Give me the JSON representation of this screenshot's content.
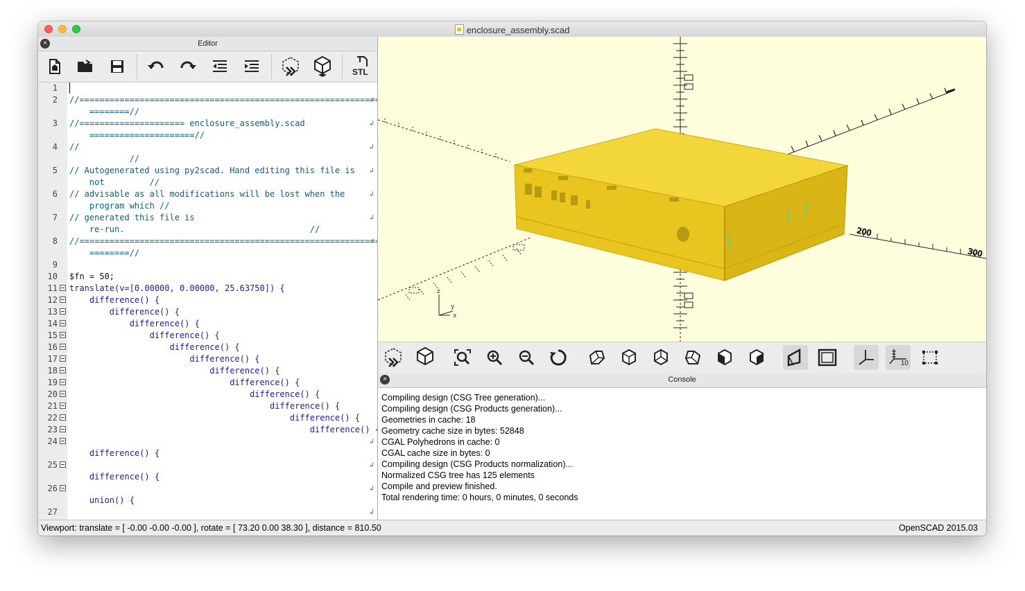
{
  "window": {
    "title": "enclosure_assembly.scad"
  },
  "editor": {
    "title": "Editor",
    "close_glyph": "×",
    "toolbar": [
      {
        "name": "new-file-icon"
      },
      {
        "name": "open-file-icon"
      },
      {
        "name": "save-icon"
      },
      {
        "name": "undo-icon"
      },
      {
        "name": "redo-icon"
      },
      {
        "name": "unindent-icon"
      },
      {
        "name": "indent-icon"
      },
      {
        "name": "preview-icon"
      },
      {
        "name": "render-icon"
      },
      {
        "name": "export-stl-icon",
        "label": "STL"
      }
    ],
    "lines": [
      {
        "n": "1",
        "text": "",
        "color": "teal"
      },
      {
        "n": "2",
        "text": "//================================================================",
        "color": "teal",
        "wrap": true
      },
      {
        "n": "",
        "text": "    ========//",
        "color": "teal"
      },
      {
        "n": "3",
        "text": "//===================== enclosure_assembly.scad",
        "color": "teal",
        "wrap": true
      },
      {
        "n": "",
        "text": "    =====================//",
        "color": "teal"
      },
      {
        "n": "4",
        "text": "//",
        "color": "teal",
        "wrap": true
      },
      {
        "n": "",
        "text": "            //",
        "color": "teal"
      },
      {
        "n": "5",
        "text": "// Autogenerated using py2scad. Hand editing this file is",
        "color": "teal",
        "wrap": true
      },
      {
        "n": "",
        "text": "    not         //",
        "color": "teal"
      },
      {
        "n": "6",
        "text": "// advisable as all modifications will be lost when the",
        "color": "teal",
        "wrap": true
      },
      {
        "n": "",
        "text": "    program which //",
        "color": "teal"
      },
      {
        "n": "7",
        "text": "// generated this file is",
        "color": "teal",
        "wrap": true
      },
      {
        "n": "",
        "text": "    re-run.                                     //",
        "color": "teal"
      },
      {
        "n": "8",
        "text": "//================================================================",
        "color": "teal",
        "wrap": true
      },
      {
        "n": "",
        "text": "    ========//",
        "color": "teal"
      },
      {
        "n": "9",
        "text": "",
        "color": "black"
      },
      {
        "n": "10",
        "text": "$fn = 50;",
        "color": "black"
      },
      {
        "n": "11",
        "text": "translate(v=[0.00000, 0.00000, 25.63750]) {",
        "color": "blue",
        "fold": true
      },
      {
        "n": "12",
        "text": "    difference() {",
        "color": "blue",
        "fold": true
      },
      {
        "n": "13",
        "text": "        difference() {",
        "color": "blue",
        "fold": true
      },
      {
        "n": "14",
        "text": "            difference() {",
        "color": "blue",
        "fold": true
      },
      {
        "n": "15",
        "text": "                difference() {",
        "color": "blue",
        "fold": true
      },
      {
        "n": "16",
        "text": "                    difference() {",
        "color": "blue",
        "fold": true
      },
      {
        "n": "17",
        "text": "                        difference() {",
        "color": "blue",
        "fold": true
      },
      {
        "n": "18",
        "text": "                            difference() {",
        "color": "blue",
        "fold": true
      },
      {
        "n": "19",
        "text": "                                difference() {",
        "color": "blue",
        "fold": true
      },
      {
        "n": "20",
        "text": "                                    difference() {",
        "color": "blue",
        "fold": true
      },
      {
        "n": "21",
        "text": "                                        difference() {",
        "color": "blue",
        "fold": true
      },
      {
        "n": "22",
        "text": "                                            difference() {",
        "color": "blue",
        "fold": true
      },
      {
        "n": "23",
        "text": "                                                difference() {",
        "color": "blue",
        "fold": true
      },
      {
        "n": "24",
        "text": "",
        "color": "blue",
        "fold": true,
        "wrap": true
      },
      {
        "n": "",
        "text": "    difference() {",
        "color": "blue"
      },
      {
        "n": "25",
        "text": "",
        "color": "blue",
        "fold": true,
        "wrap": true
      },
      {
        "n": "",
        "text": "    difference() {",
        "color": "blue"
      },
      {
        "n": "26",
        "text": "",
        "color": "blue",
        "fold": true,
        "wrap": true
      },
      {
        "n": "",
        "text": "    union() {",
        "color": "blue"
      },
      {
        "n": "27",
        "text": "",
        "color": "blue",
        "wrap": true
      }
    ]
  },
  "viewport_toolbar": [
    {
      "name": "preview-icon"
    },
    {
      "name": "render-icon"
    },
    {
      "name": "view-all-icon"
    },
    {
      "name": "zoom-in-icon"
    },
    {
      "name": "zoom-out-icon"
    },
    {
      "name": "reset-view-icon"
    },
    {
      "name": "view-right-icon"
    },
    {
      "name": "view-top-icon"
    },
    {
      "name": "view-bottom-icon"
    },
    {
      "name": "view-left-icon"
    },
    {
      "name": "view-front-icon"
    },
    {
      "name": "view-back-icon"
    },
    {
      "name": "perspective-icon",
      "active": true
    },
    {
      "name": "orthogonal-icon"
    },
    {
      "name": "show-axes-icon",
      "active": true
    },
    {
      "name": "show-scale-markers-icon",
      "active": true,
      "label": "10"
    },
    {
      "name": "show-edges-icon"
    }
  ],
  "viewport": {
    "model_color": "#f0cf2a",
    "background": "#fffedc",
    "axis_labels": [
      "z",
      "y",
      "x"
    ]
  },
  "console": {
    "title": "Console",
    "lines": [
      "Compiling design (CSG Tree generation)...",
      "Compiling design (CSG Products generation)...",
      "Geometries in cache: 18",
      "Geometry cache size in bytes: 52848",
      "CGAL Polyhedrons in cache: 0",
      "CGAL cache size in bytes: 0",
      "Compiling design (CSG Products normalization)...",
      "Normalized CSG tree has 125 elements",
      "Compile and preview finished.",
      "Total rendering time: 0 hours, 0 minutes, 0 seconds"
    ]
  },
  "status": {
    "viewport": "Viewport: translate = [ -0.00 -0.00 -0.00 ], rotate = [ 73.20 0.00 38.30 ], distance = 810.50",
    "version": "OpenSCAD 2015.03"
  }
}
